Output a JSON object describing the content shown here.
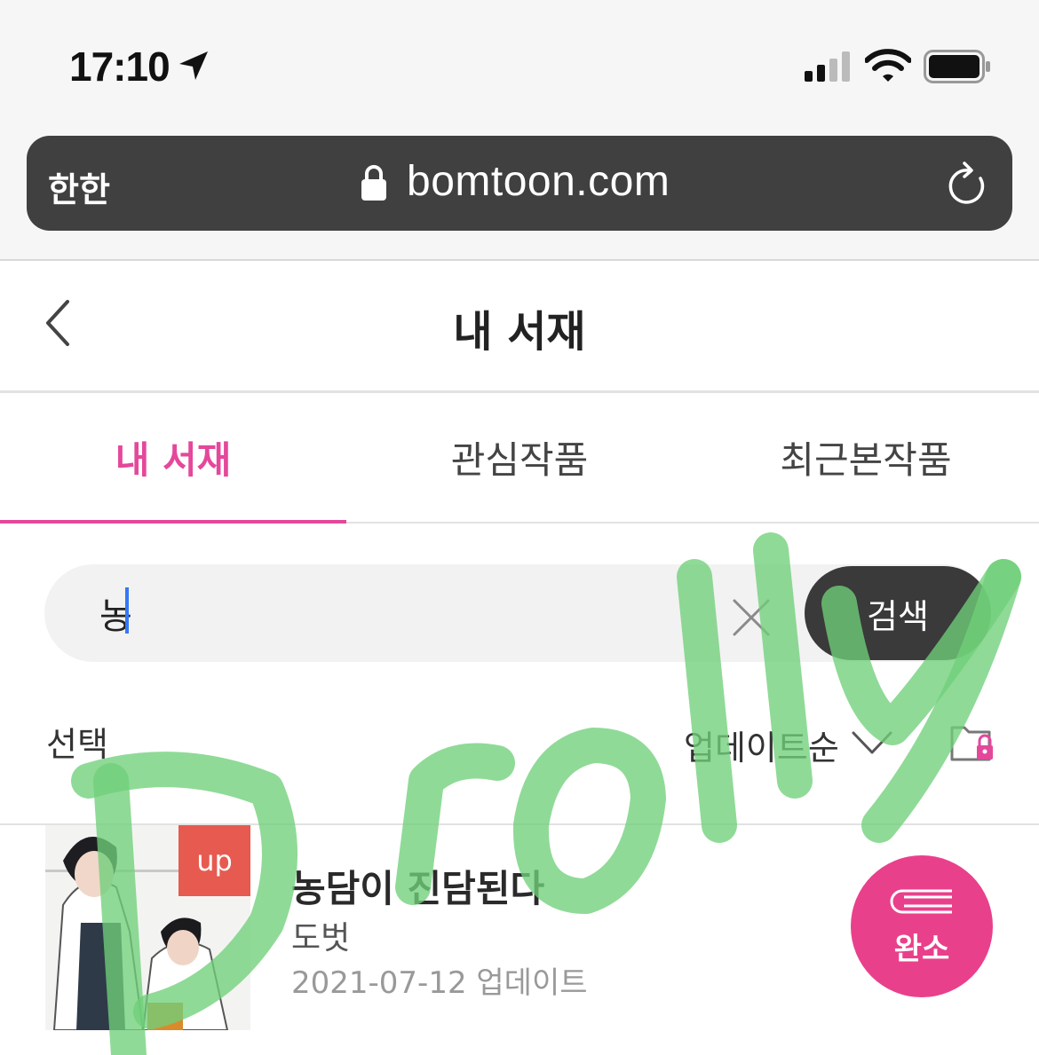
{
  "status_bar": {
    "time": "17:10"
  },
  "browser": {
    "reader_label": "한한",
    "url": "bomtoon.com"
  },
  "header": {
    "title": "내 서재"
  },
  "tabs": [
    {
      "label": "내 서재",
      "active": true
    },
    {
      "label": "관심작품",
      "active": false
    },
    {
      "label": "최근본작품",
      "active": false
    }
  ],
  "search": {
    "value": "농",
    "button_label": "검색"
  },
  "toolbar": {
    "select_label": "선택",
    "sort_label": "업데이트순"
  },
  "books": [
    {
      "badge": "up",
      "title": "농담이 진담된다",
      "author": "도벗",
      "date": "2021-07-12 업데이트",
      "status": "완소"
    }
  ],
  "colors": {
    "accent": "#e4489b",
    "badge_pink": "#e9408b",
    "up_badge": "#e65a50",
    "watermark": "#6fd07a"
  }
}
